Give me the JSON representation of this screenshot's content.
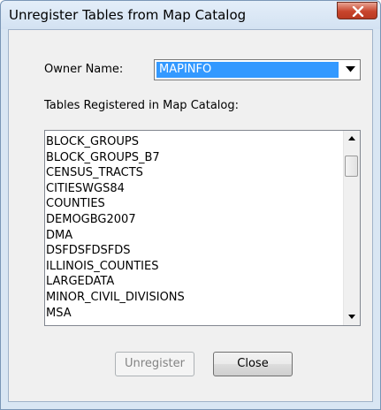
{
  "window": {
    "title": "Unregister Tables from Map Catalog"
  },
  "owner": {
    "label": "Owner Name:",
    "selected": "MAPINFO"
  },
  "tables": {
    "label": "Tables Registered in Map Catalog:",
    "items": [
      "BLOCK_GROUPS",
      "BLOCK_GROUPS_B7",
      "CENSUS_TRACTS",
      "CITIESWGS84",
      "COUNTIES",
      "DEMOGBG2007",
      "DMA",
      "DSFDSFDSFDS",
      "ILLINOIS_COUNTIES",
      "LARGEDATA",
      "MINOR_CIVIL_DIVISIONS",
      "MSA"
    ]
  },
  "buttons": {
    "unregister": "Unregister",
    "close": "Close"
  },
  "icons": {
    "title_close": "close-icon",
    "dropdown": "triangle-down-icon",
    "scroll_up": "triangle-up-icon",
    "scroll_down": "triangle-down-icon"
  },
  "colors": {
    "selection": "#3399ff",
    "close_button": "#c8452c"
  }
}
